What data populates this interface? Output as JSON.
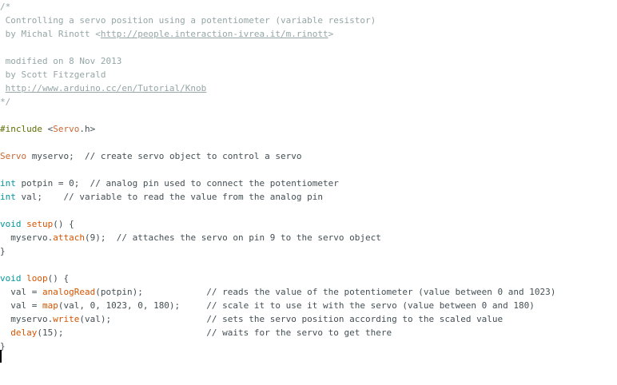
{
  "editor": {
    "lines": [
      [
        {
          "t": "/*",
          "c": "cm"
        }
      ],
      [
        {
          "t": " Controlling a servo position using a potentiometer (variable resistor)",
          "c": "cm"
        }
      ],
      [
        {
          "t": " by Michal Rinott <",
          "c": "cm"
        },
        {
          "t": "http://people.interaction-ivrea.it/m.rinott",
          "c": "cm ln"
        },
        {
          "t": ">",
          "c": "cm"
        }
      ],
      [],
      [
        {
          "t": " modified on 8 Nov 2013",
          "c": "cm"
        }
      ],
      [
        {
          "t": " by Scott Fitzgerald",
          "c": "cm"
        }
      ],
      [
        {
          "t": " ",
          "c": "cm"
        },
        {
          "t": "http://www.arduino.cc/en/Tutorial/Knob",
          "c": "cm ln"
        }
      ],
      [
        {
          "t": "*/",
          "c": "cm"
        }
      ],
      [],
      [
        {
          "t": "#include",
          "c": "pp"
        },
        {
          "t": " <",
          "c": "pl"
        },
        {
          "t": "Servo",
          "c": "ty"
        },
        {
          "t": ".h>",
          "c": "pl"
        }
      ],
      [],
      [
        {
          "t": "Servo",
          "c": "ty"
        },
        {
          "t": " myservo;  ",
          "c": "pl"
        },
        {
          "t": "// create servo object to control a servo",
          "c": "pl"
        }
      ],
      [],
      [
        {
          "t": "int",
          "c": "kw"
        },
        {
          "t": " potpin = 0;  ",
          "c": "pl"
        },
        {
          "t": "// analog pin used to connect the potentiometer",
          "c": "pl"
        }
      ],
      [
        {
          "t": "int",
          "c": "kw"
        },
        {
          "t": " val;    ",
          "c": "pl"
        },
        {
          "t": "// variable to read the value from the analog pin",
          "c": "pl"
        }
      ],
      [],
      [
        {
          "t": "void",
          "c": "kw"
        },
        {
          "t": " ",
          "c": "pl"
        },
        {
          "t": "setup",
          "c": "fn"
        },
        {
          "t": "() {",
          "c": "pl"
        }
      ],
      [
        {
          "t": "  myservo.",
          "c": "pl"
        },
        {
          "t": "attach",
          "c": "fn"
        },
        {
          "t": "(9);  ",
          "c": "pl"
        },
        {
          "t": "// attaches the servo on pin 9 to the servo object",
          "c": "pl"
        }
      ],
      [
        {
          "t": "}",
          "c": "pl"
        }
      ],
      [],
      [
        {
          "t": "void",
          "c": "kw"
        },
        {
          "t": " ",
          "c": "pl"
        },
        {
          "t": "loop",
          "c": "fn"
        },
        {
          "t": "() {",
          "c": "pl"
        }
      ],
      [
        {
          "t": "  val = ",
          "c": "pl"
        },
        {
          "t": "analogRead",
          "c": "fn"
        },
        {
          "t": "(potpin);            ",
          "c": "pl"
        },
        {
          "t": "// reads the value of the potentiometer (value between 0 and 1023)",
          "c": "pl"
        }
      ],
      [
        {
          "t": "  val = ",
          "c": "pl"
        },
        {
          "t": "map",
          "c": "fn"
        },
        {
          "t": "(val, 0, 1023, 0, 180);     ",
          "c": "pl"
        },
        {
          "t": "// scale it to use it with the servo (value between 0 and 180)",
          "c": "pl"
        }
      ],
      [
        {
          "t": "  myservo.",
          "c": "pl"
        },
        {
          "t": "write",
          "c": "fn"
        },
        {
          "t": "(val);                  ",
          "c": "pl"
        },
        {
          "t": "// sets the servo position according to the scaled value",
          "c": "pl"
        }
      ],
      [
        {
          "t": "  ",
          "c": "pl"
        },
        {
          "t": "delay",
          "c": "fn"
        },
        {
          "t": "(15);                           ",
          "c": "pl"
        },
        {
          "t": "// waits for the servo to get there",
          "c": "pl"
        }
      ],
      [
        {
          "t": "}",
          "c": "pl"
        }
      ]
    ]
  }
}
